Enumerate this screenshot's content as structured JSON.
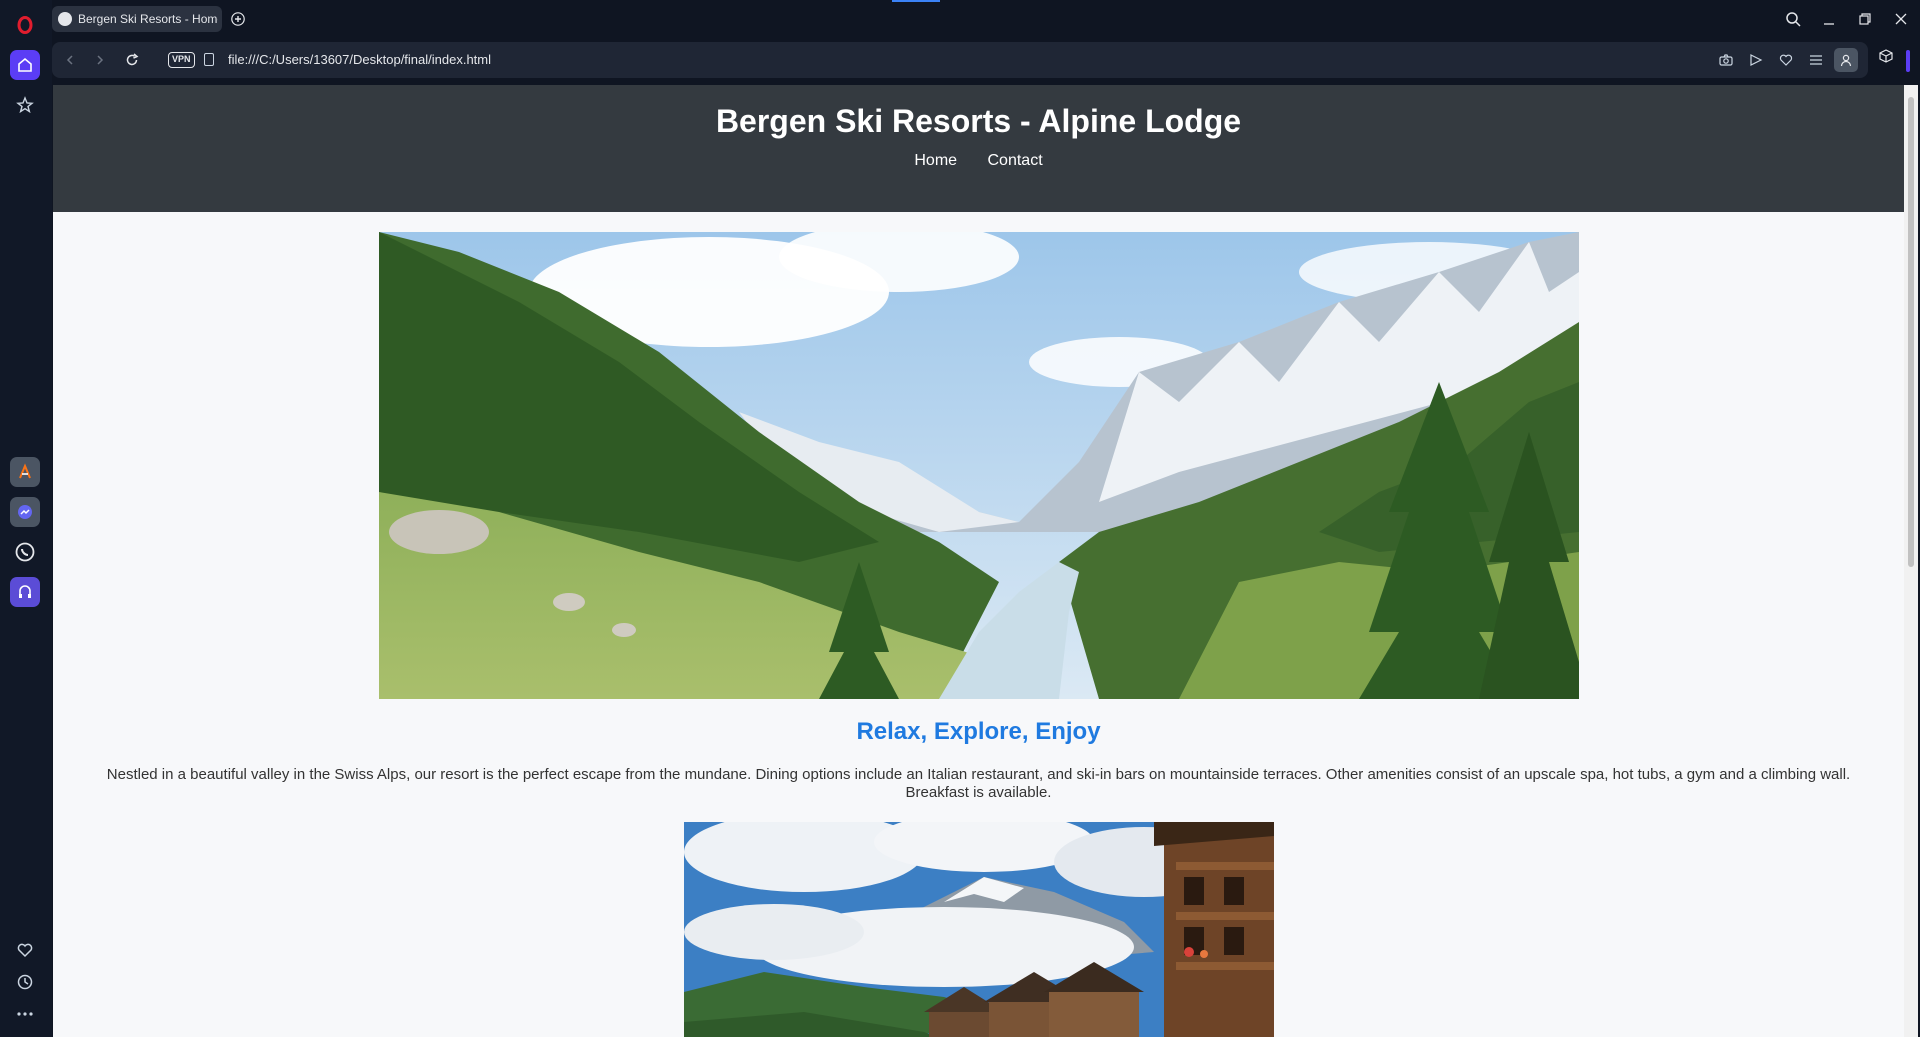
{
  "browser": {
    "tab_title": "Bergen Ski Resorts - Home",
    "url": "file:///C:/Users/13607/Desktop/final/index.html",
    "vpn_label": "VPN"
  },
  "site": {
    "title": "Bergen Ski Resorts - Alpine Lodge",
    "nav": [
      "Home",
      "Contact"
    ],
    "section_heading": "Relax, Explore, Enjoy",
    "description": "Nestled in a beautiful valley in the Swiss Alps, our resort is the perfect escape from the mundane. Dining options include an Italian restaurant, and ski-in bars on mountainside terraces. Other amenities consist of an upscale spa, hot tubs, a gym and a climbing wall. Breakfast is available."
  },
  "colors": {
    "header_bg": "#343a40",
    "heading_blue": "#1f7ae0",
    "accent": "#5b3df5"
  },
  "icons": [
    "opera-logo-icon",
    "home-icon",
    "star-icon",
    "aria-icon",
    "messenger-icon",
    "whatsapp-icon",
    "music-icon",
    "heart-icon",
    "history-icon",
    "more-icon",
    "search-icon",
    "minimize-icon",
    "restore-icon",
    "close-icon",
    "back-icon",
    "forward-icon",
    "reload-icon",
    "camera-icon",
    "send-icon",
    "heart-icon",
    "menu-icon",
    "profile-icon",
    "extensions-icon"
  ]
}
